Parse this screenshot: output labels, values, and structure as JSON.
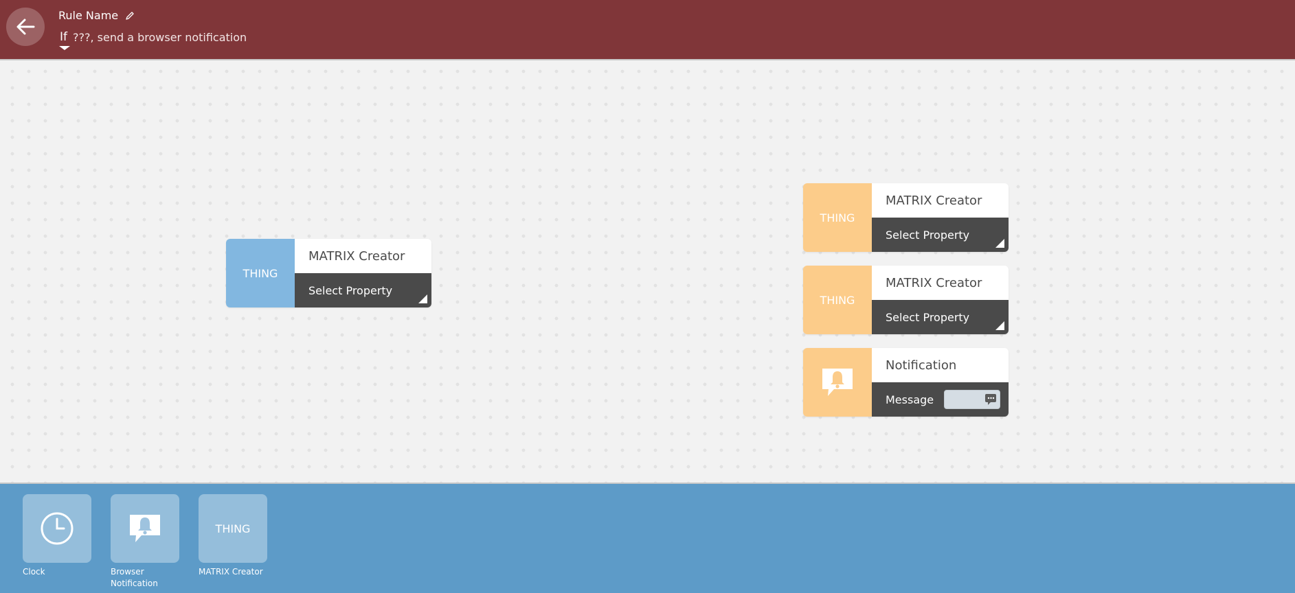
{
  "header": {
    "rule_name": "Rule Name",
    "if_label": "If",
    "description": "???, send a browser notification"
  },
  "canvas": {
    "blocks": [
      {
        "role": "trigger",
        "icon_label": "THING",
        "title": "MATRIX Creator",
        "select_label": "Select Property"
      },
      {
        "role": "effect",
        "icon_label": "THING",
        "title": "MATRIX Creator",
        "select_label": "Select Property"
      },
      {
        "role": "effect",
        "icon_label": "THING",
        "title": "MATRIX Creator",
        "select_label": "Select Property"
      },
      {
        "role": "effect",
        "icon": "bell-speech-icon",
        "title": "Notification",
        "field_label": "Message"
      }
    ]
  },
  "palette": {
    "items": [
      {
        "icon": "clock-icon",
        "label": "Clock"
      },
      {
        "icon": "bell-speech-icon",
        "label": "Browser Notification"
      },
      {
        "icon_label": "THING",
        "label": "MATRIX Creator"
      }
    ]
  },
  "colors": {
    "header_bg": "#803639",
    "canvas_bg": "#f2f2f2",
    "palette_bg": "#5d9bc8",
    "trigger_accent": "#82b7e0",
    "effect_accent": "#fccc8a",
    "block_select_bg": "#4a4a4a"
  }
}
